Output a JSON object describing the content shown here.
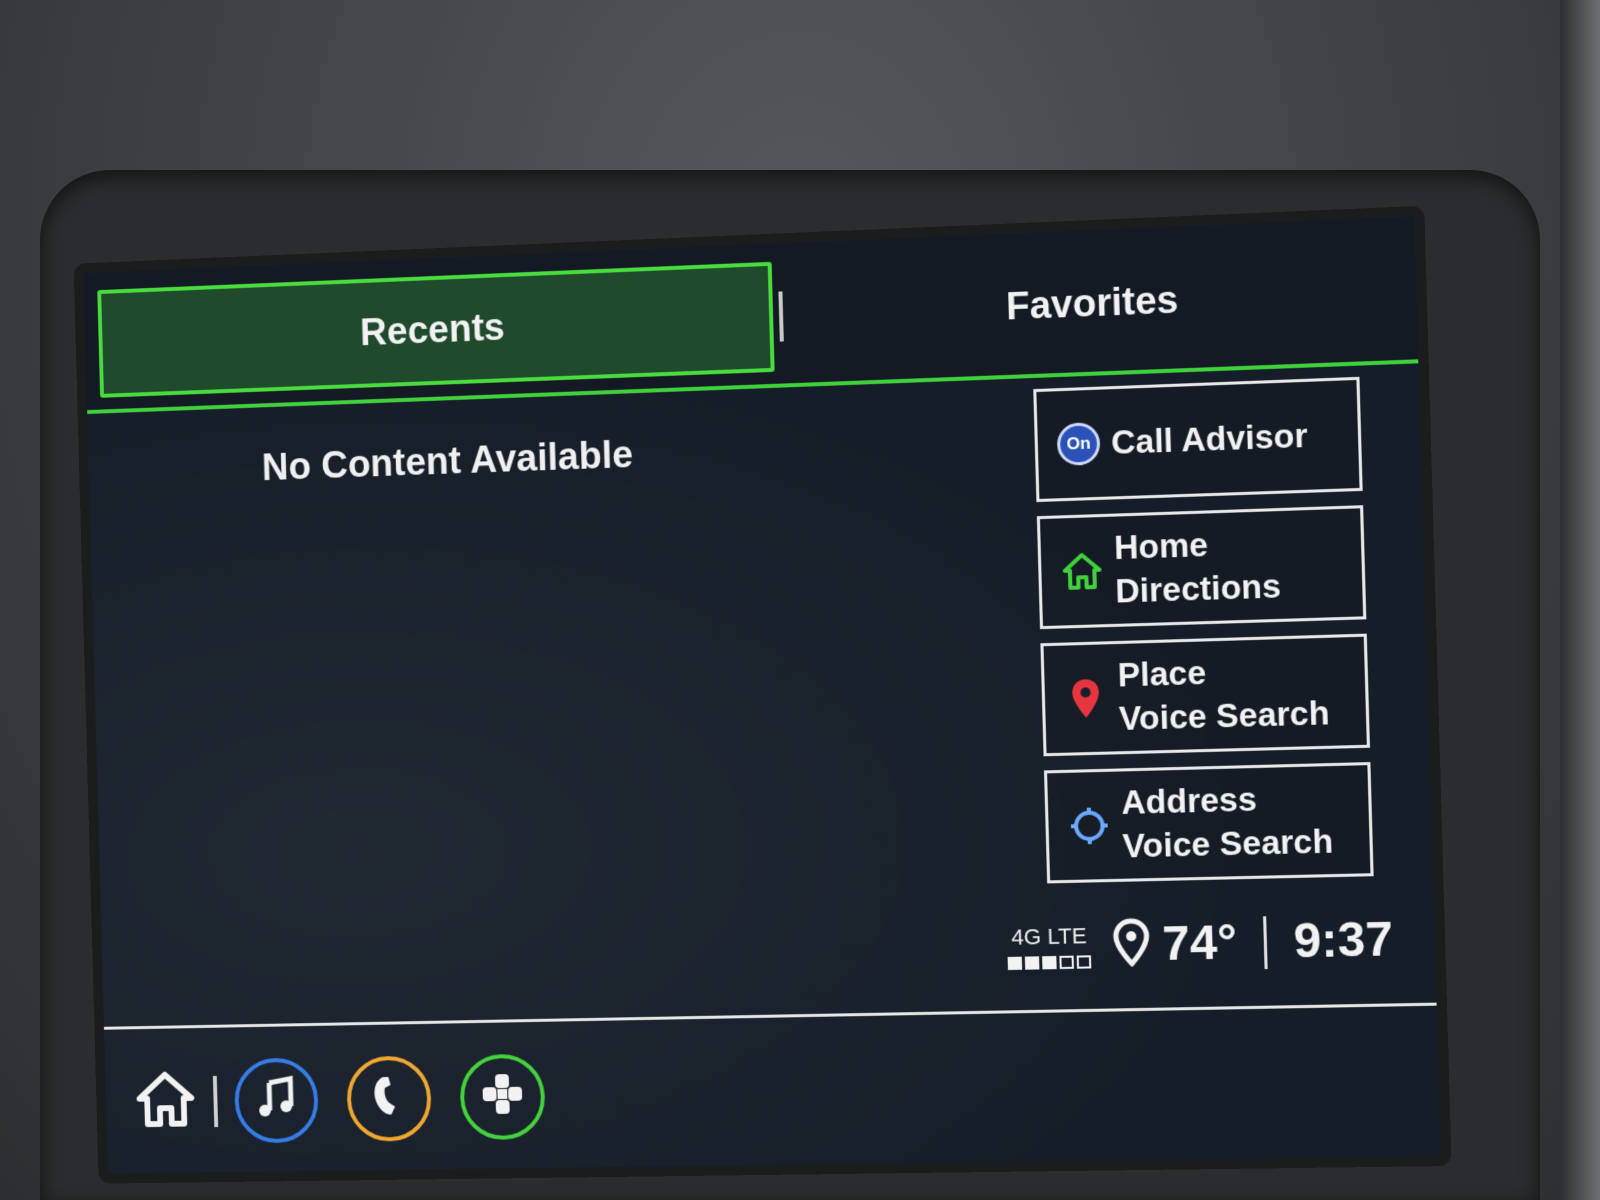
{
  "tabs": {
    "recents": "Recents",
    "favorites": "Favorites"
  },
  "content": {
    "empty_message": "No Content Available"
  },
  "actions": [
    {
      "line1": "Call Advisor",
      "line2": "",
      "icon": "onstar-icon",
      "icon_text": "On"
    },
    {
      "line1": "Home",
      "line2": "Directions",
      "icon": "home-icon",
      "icon_color": "#3fd13a"
    },
    {
      "line1": "Place",
      "line2": "Voice Search",
      "icon": "location-pin-icon",
      "icon_color": "#e8333d"
    },
    {
      "line1": "Address",
      "line2": "Voice Search",
      "icon": "address-target-icon",
      "icon_color": "#6aa8ff"
    }
  ],
  "status": {
    "network": "4G LTE",
    "signal_bars": 3,
    "signal_total": 5,
    "temperature": "74°",
    "time": "9:37"
  },
  "dock": [
    {
      "name": "home",
      "icon": "home-icon"
    },
    {
      "name": "audio",
      "icon": "music-note-icon",
      "color": "#2f7ae6"
    },
    {
      "name": "phone",
      "icon": "phone-icon",
      "color": "#f0a52c"
    },
    {
      "name": "apps",
      "icon": "apps-icon",
      "color": "#3fd13a"
    }
  ],
  "colors": {
    "accent_green": "#3fd13a",
    "tab_active_bg": "#1f4a2b",
    "screen_bg": "#151d28"
  }
}
